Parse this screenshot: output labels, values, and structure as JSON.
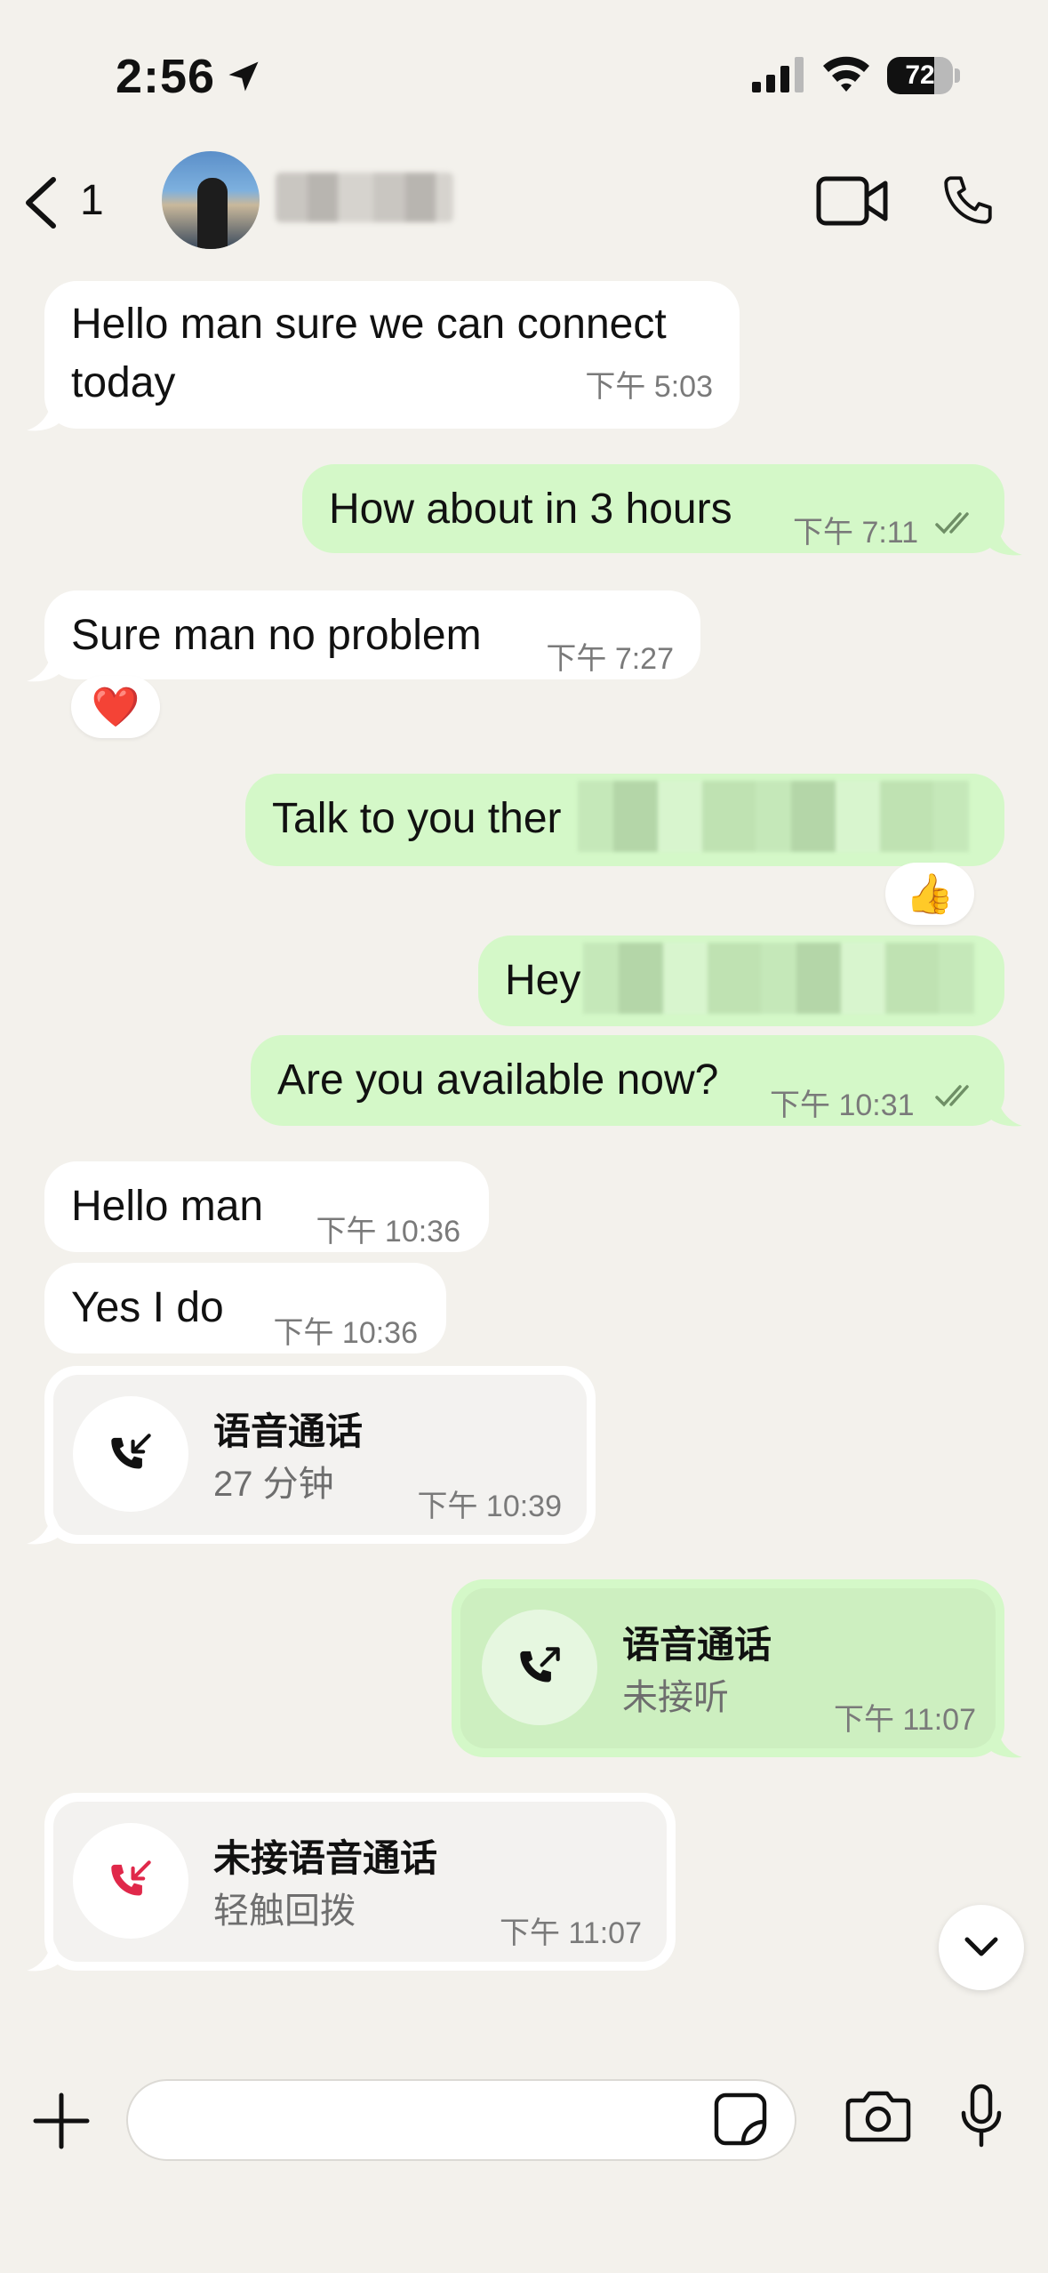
{
  "status": {
    "time": "2:56",
    "battery": "72",
    "battery_level": 0.72
  },
  "header": {
    "unread_count": "1"
  },
  "messages": [
    {
      "dir": "in",
      "line1": "Hello man sure we can connect",
      "line2": "today",
      "time": "下午 5:03"
    },
    {
      "dir": "out",
      "text": "How about in 3 hours",
      "time": "下午 7:11"
    },
    {
      "dir": "in",
      "text": "Sure man no problem",
      "time": "下午 7:27",
      "reaction": "❤️"
    },
    {
      "dir": "out",
      "text": "Talk to you ther",
      "reaction": "👍"
    },
    {
      "dir": "out",
      "text": "Hey"
    },
    {
      "dir": "out",
      "text": "Are you available now?",
      "time": "下午 10:31"
    },
    {
      "dir": "in",
      "text": "Hello man",
      "time": "下午 10:36"
    },
    {
      "dir": "in",
      "text": "Yes I do",
      "time": "下午 10:36"
    }
  ],
  "calls": [
    {
      "title": "语音通话",
      "sub": "27 分钟",
      "time": "下午 10:39"
    },
    {
      "title": "语音通话",
      "sub": "未接听",
      "time": "下午 11:07"
    },
    {
      "title": "未接语音通话",
      "sub": "轻触回拨",
      "time": "下午 11:07"
    }
  ],
  "composer": {
    "placeholder": ""
  },
  "colors": {
    "incoming": "#ffffff",
    "outgoing": "#d4f8c8",
    "missed": "#e0284a",
    "background": "#f3f1ec"
  },
  "icons": [
    "back-chevron-icon",
    "video-camera-icon",
    "phone-icon",
    "location-arrow-icon",
    "signal-icon",
    "wifi-icon",
    "plus-icon",
    "sticker-icon",
    "camera-icon",
    "microphone-icon",
    "chevron-down-icon"
  ]
}
